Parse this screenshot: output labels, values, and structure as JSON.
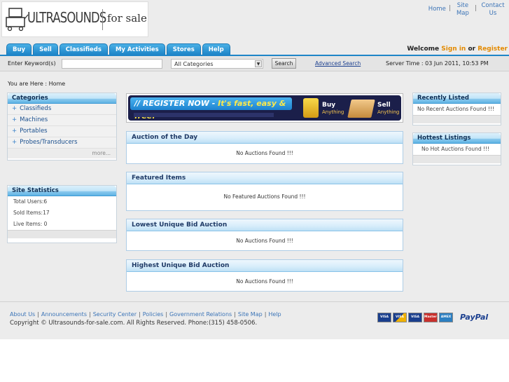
{
  "header": {
    "logo_main": "ULTRASOUNDS",
    "logo_suffix": "for sale",
    "top_links": {
      "home": "Home",
      "site_map": "Site Map",
      "contact": "Contact Us"
    }
  },
  "tabs": [
    "Buy",
    "Sell",
    "Classifieds",
    "My Activities",
    "Stores",
    "Help"
  ],
  "welcome": {
    "prefix": "Welcome",
    "sign_in": "Sign in",
    "or": "or",
    "register": "Register"
  },
  "search": {
    "label": "Enter Keyword(s)",
    "keyword_value": "",
    "category_selected": "All Categories",
    "button": "Search",
    "advanced": "Advanced Search",
    "server_time": "Server Time : 03 Jun 2011, 10:53 PM"
  },
  "breadcrumb": "You are Here : Home",
  "categories": {
    "title": "Categories",
    "items": [
      "Classifieds",
      "Machines",
      "Portables",
      "Probes/Transducers"
    ],
    "more": "more..."
  },
  "site_stats": {
    "title": "Site Statistics",
    "rows": [
      "Total Users:6",
      "Sold Items:17",
      "Live Items: 0"
    ]
  },
  "banner": {
    "register_prefix": "// REGISTER NOW - ",
    "register_rest": "It's fast, easy & free!",
    "buy": "Buy",
    "buy_sub": "Anything",
    "sell": "Sell",
    "sell_sub": "Anything"
  },
  "panels": [
    {
      "title": "Auction of the Day",
      "message": "No Auctions Found !!!"
    },
    {
      "title": "Featured Items",
      "message": "No Featured Auctions Found !!!"
    },
    {
      "title": "Lowest Unique Bid Auction",
      "message": "No Auctions Found !!!"
    },
    {
      "title": "Highest Unique Bid Auction",
      "message": "No Auctions Found !!!"
    }
  ],
  "recently_listed": {
    "title": "Recently Listed",
    "message": "No Recent Auctions Found !!!"
  },
  "hottest": {
    "title": "Hottest Listings",
    "message": "No Hot Auctions Found !!!"
  },
  "footer": {
    "links": [
      "About Us",
      "Announcements",
      "Security Center",
      "Policies",
      "Government Relations",
      "Site Map",
      "Help"
    ],
    "copyright": "Copyright © Ultrasounds-for-sale.com. All Rights Reserved. Phone:(315) 458-0506.",
    "cards": [
      "VISA Electron",
      "VISA",
      "VISA",
      "MasterCard",
      "AMEX"
    ],
    "paypal": "PayPal"
  },
  "colors": {
    "tab_blue": "#1e85c8",
    "link_blue": "#3b74b7",
    "signin_orange": "#e38a00",
    "banner_navy": "#1b1f4a"
  }
}
